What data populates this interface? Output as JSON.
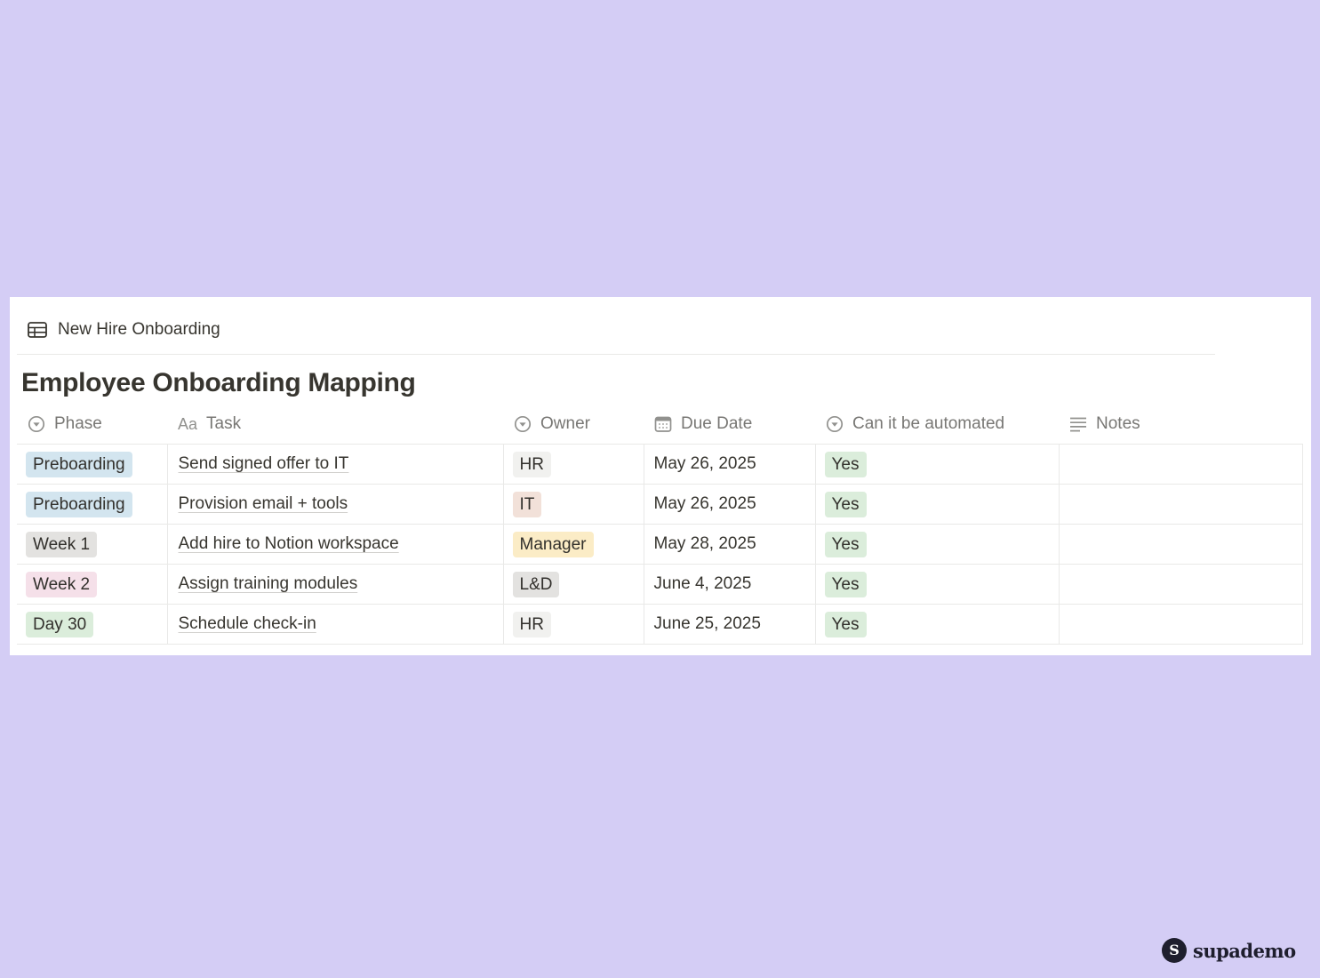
{
  "view": {
    "tab_label": "New Hire Onboarding"
  },
  "page": {
    "title": "Employee Onboarding Mapping"
  },
  "columns": {
    "phase": {
      "label": "Phase",
      "icon": "select-icon"
    },
    "task": {
      "label": "Task",
      "icon_text": "Aa"
    },
    "owner": {
      "label": "Owner",
      "icon": "select-icon"
    },
    "due_date": {
      "label": "Due Date",
      "icon": "calendar-icon"
    },
    "automated": {
      "label": "Can it be automated",
      "icon": "select-icon"
    },
    "notes": {
      "label": "Notes",
      "icon": "text-lines-icon"
    }
  },
  "rows": [
    {
      "phase": "Preboarding",
      "task": "Send signed offer to IT",
      "owner": "HR",
      "due_date": "May 26, 2025",
      "automated": "Yes",
      "notes": ""
    },
    {
      "phase": "Preboarding",
      "task": "Provision email + tools",
      "owner": "IT",
      "due_date": "May 26, 2025",
      "automated": "Yes",
      "notes": ""
    },
    {
      "phase": "Week 1",
      "task": "Add hire to Notion workspace",
      "owner": "Manager",
      "due_date": "May 28, 2025",
      "automated": "Yes",
      "notes": ""
    },
    {
      "phase": "Week 2",
      "task": "Assign training modules",
      "owner": "L&D",
      "due_date": "June 4, 2025",
      "automated": "Yes",
      "notes": ""
    },
    {
      "phase": "Day 30",
      "task": "Schedule check-in",
      "owner": "HR",
      "due_date": "June 25, 2025",
      "automated": "Yes",
      "notes": ""
    }
  ],
  "tag_colors": {
    "Preboarding": "#d3e5ef",
    "Week 1": "#e3e2e0",
    "Week 2": "#f5e0e9",
    "Day 30": "#dbeddb",
    "HR": "#f1f1ef",
    "IT": "#f2e1d9",
    "Manager": "#fbecc6",
    "L&D": "#e3e2e0",
    "Yes": "#dbeddb"
  },
  "branding": {
    "logo_letter": "S",
    "name": "supademo"
  }
}
